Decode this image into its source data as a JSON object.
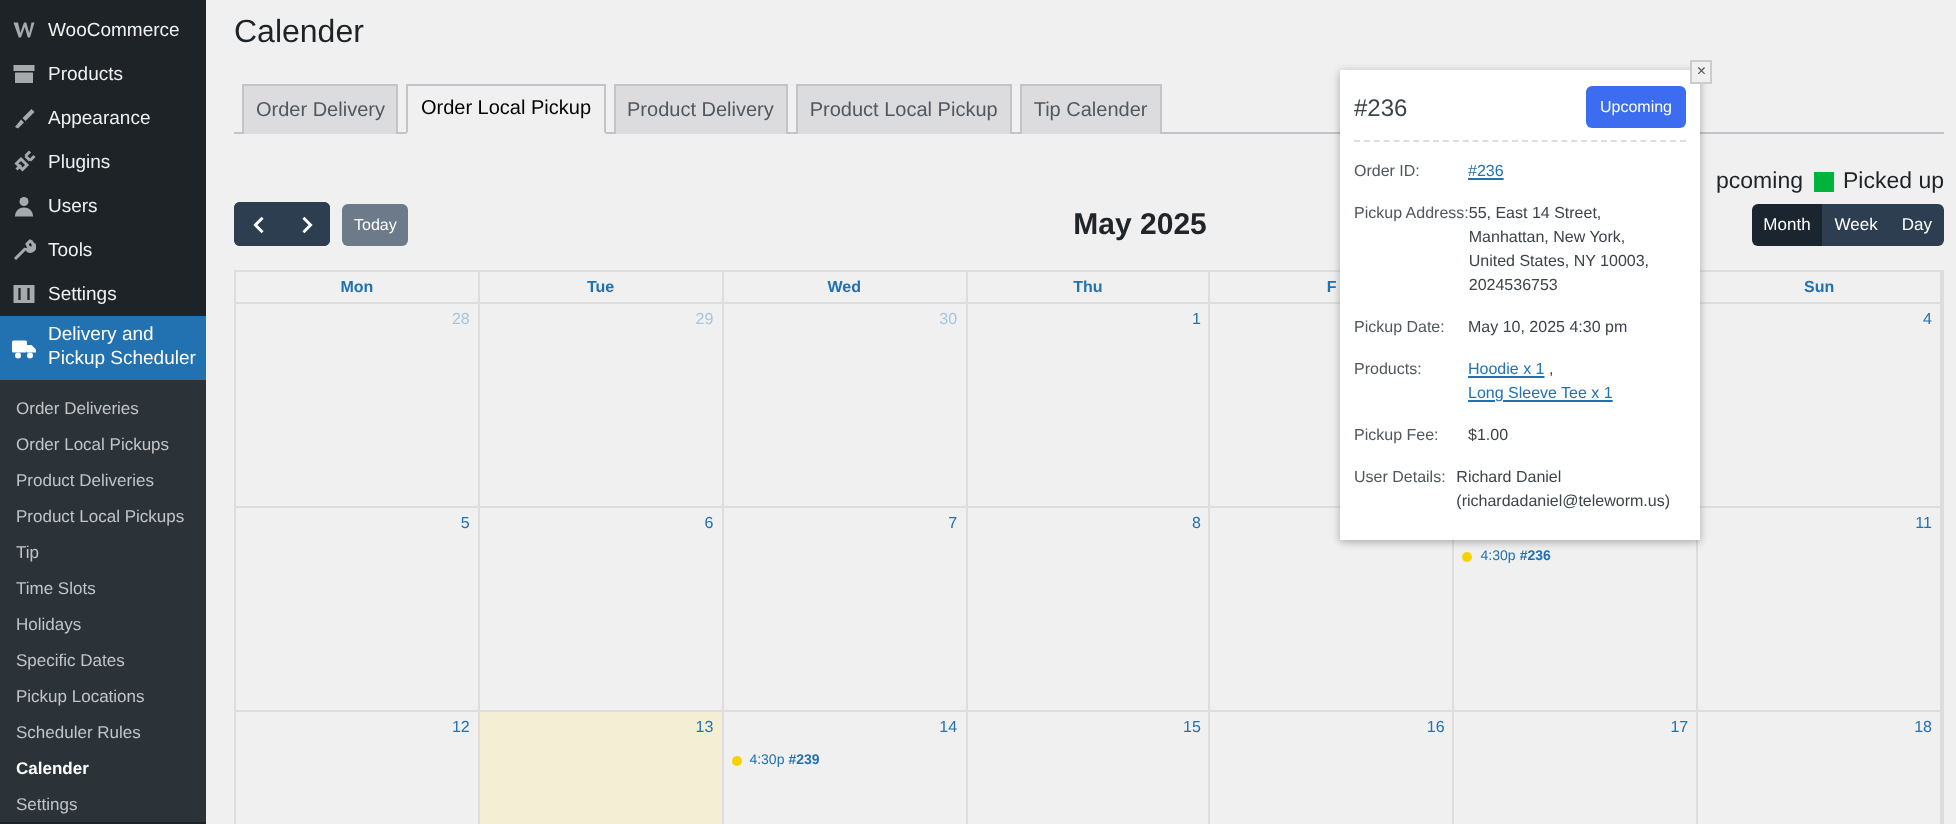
{
  "sidebar": {
    "menu": [
      {
        "label": "WooCommerce",
        "current": false
      },
      {
        "label": "Products",
        "current": false
      },
      {
        "label": "Appearance",
        "current": false
      },
      {
        "label": "Plugins",
        "current": false
      },
      {
        "label": "Users",
        "current": false
      },
      {
        "label": "Tools",
        "current": false
      },
      {
        "label": "Settings",
        "current": false
      },
      {
        "label": "Delivery and Pickup Scheduler",
        "current": true
      }
    ],
    "submenu": [
      {
        "label": "Order Deliveries",
        "selected": false
      },
      {
        "label": "Order Local Pickups",
        "selected": false
      },
      {
        "label": "Product Deliveries",
        "selected": false
      },
      {
        "label": "Product Local Pickups",
        "selected": false
      },
      {
        "label": "Tip",
        "selected": false
      },
      {
        "label": "Time Slots",
        "selected": false
      },
      {
        "label": "Holidays",
        "selected": false
      },
      {
        "label": "Specific Dates",
        "selected": false
      },
      {
        "label": "Pickup Locations",
        "selected": false
      },
      {
        "label": "Scheduler Rules",
        "selected": false
      },
      {
        "label": "Calender",
        "selected": true
      },
      {
        "label": "Settings",
        "selected": false
      }
    ]
  },
  "page_title": "Calender",
  "tabs": [
    {
      "label": "Order Delivery",
      "selected": false
    },
    {
      "label": "Order Local Pickup",
      "selected": true
    },
    {
      "label": "Product Delivery",
      "selected": false
    },
    {
      "label": "Product Local Pickup",
      "selected": false
    },
    {
      "label": "Tip Calender",
      "selected": false
    }
  ],
  "legend": [
    {
      "label": "pcoming"
    },
    {
      "label": "Picked up",
      "color": "#00b33c"
    }
  ],
  "toolbar": {
    "today": {
      "label": "Today",
      "disabled": true
    },
    "month_title": "May 2025",
    "views": [
      {
        "label": "Month",
        "selected": true
      },
      {
        "label": "Week",
        "selected": false
      },
      {
        "label": "Day",
        "selected": false
      }
    ]
  },
  "calendar": {
    "columns": [
      {
        "label": "Mon"
      },
      {
        "label": "Tue"
      },
      {
        "label": "Wed"
      },
      {
        "label": "Thu"
      },
      {
        "label": "F"
      },
      {},
      {
        "label": "Sun"
      }
    ],
    "weeks": [
      {
        "days": [
          {
            "kind": "date",
            "day": "28",
            "other_month": true
          },
          {
            "kind": "date",
            "day": "29",
            "other_month": true
          },
          {
            "kind": "date",
            "day": "30",
            "other_month": true
          },
          {
            "kind": "date",
            "day": "1",
            "other_month": false
          },
          {
            "kind": "blank"
          },
          {
            "kind": "blank"
          },
          {
            "kind": "date",
            "day": "4",
            "other_month": false
          }
        ]
      },
      {
        "days": [
          {
            "kind": "date",
            "day": "5",
            "other_month": false
          },
          {
            "kind": "date",
            "day": "6",
            "other_month": false
          },
          {
            "kind": "date",
            "day": "7",
            "other_month": false
          },
          {
            "kind": "date",
            "day": "8",
            "other_month": false
          },
          {
            "kind": "blank"
          },
          {
            "kind": "blank",
            "events": [
              {
                "time": "4:30p",
                "order": "#236",
                "color": "#f5d300"
              }
            ]
          },
          {
            "kind": "date",
            "day": "11",
            "other_month": false
          }
        ]
      },
      {
        "days": [
          {
            "kind": "date",
            "day": "12",
            "other_month": false
          },
          {
            "kind": "date",
            "day": "13",
            "other_month": false,
            "today": true
          },
          {
            "kind": "date",
            "day": "14",
            "other_month": false,
            "events": [
              {
                "time": "4:30p",
                "order": "#239",
                "color": "#f5d300"
              }
            ]
          },
          {
            "kind": "date",
            "day": "15",
            "other_month": false
          },
          {
            "kind": "date",
            "day": "16",
            "other_month": false
          },
          {
            "kind": "date",
            "day": "17",
            "other_month": false
          },
          {
            "kind": "date",
            "day": "18",
            "other_month": false
          }
        ]
      }
    ]
  },
  "popup": {
    "close": "×",
    "title": "#236",
    "status": "Upcoming",
    "fields": [
      {
        "label": "Order ID:",
        "parts": [
          {
            "text": "#236",
            "link": true
          }
        ]
      },
      {
        "label": "Pickup Address:",
        "parts": [
          {
            "text": "55, East 14 Street, Manhattan, New York, United States, NY 10003, 2024536753",
            "link": false
          }
        ]
      },
      {
        "label": "Pickup Date:",
        "parts": [
          {
            "text": "May 10, 2025 4:30 pm",
            "link": false
          }
        ]
      },
      {
        "label": "Products:",
        "parts": [
          {
            "text": "Hoodie x 1",
            "link": true
          },
          {
            "text": " , ",
            "link": false
          },
          {
            "text": "Long Sleeve Tee x 1",
            "link": true
          }
        ]
      },
      {
        "label": "Pickup Fee:",
        "parts": [
          {
            "text": "$1.00",
            "link": false
          }
        ]
      },
      {
        "label": "User Details:",
        "parts": [
          {
            "text": "Richard Daniel (richardadaniel@teleworm.us)",
            "link": false
          }
        ]
      }
    ]
  }
}
